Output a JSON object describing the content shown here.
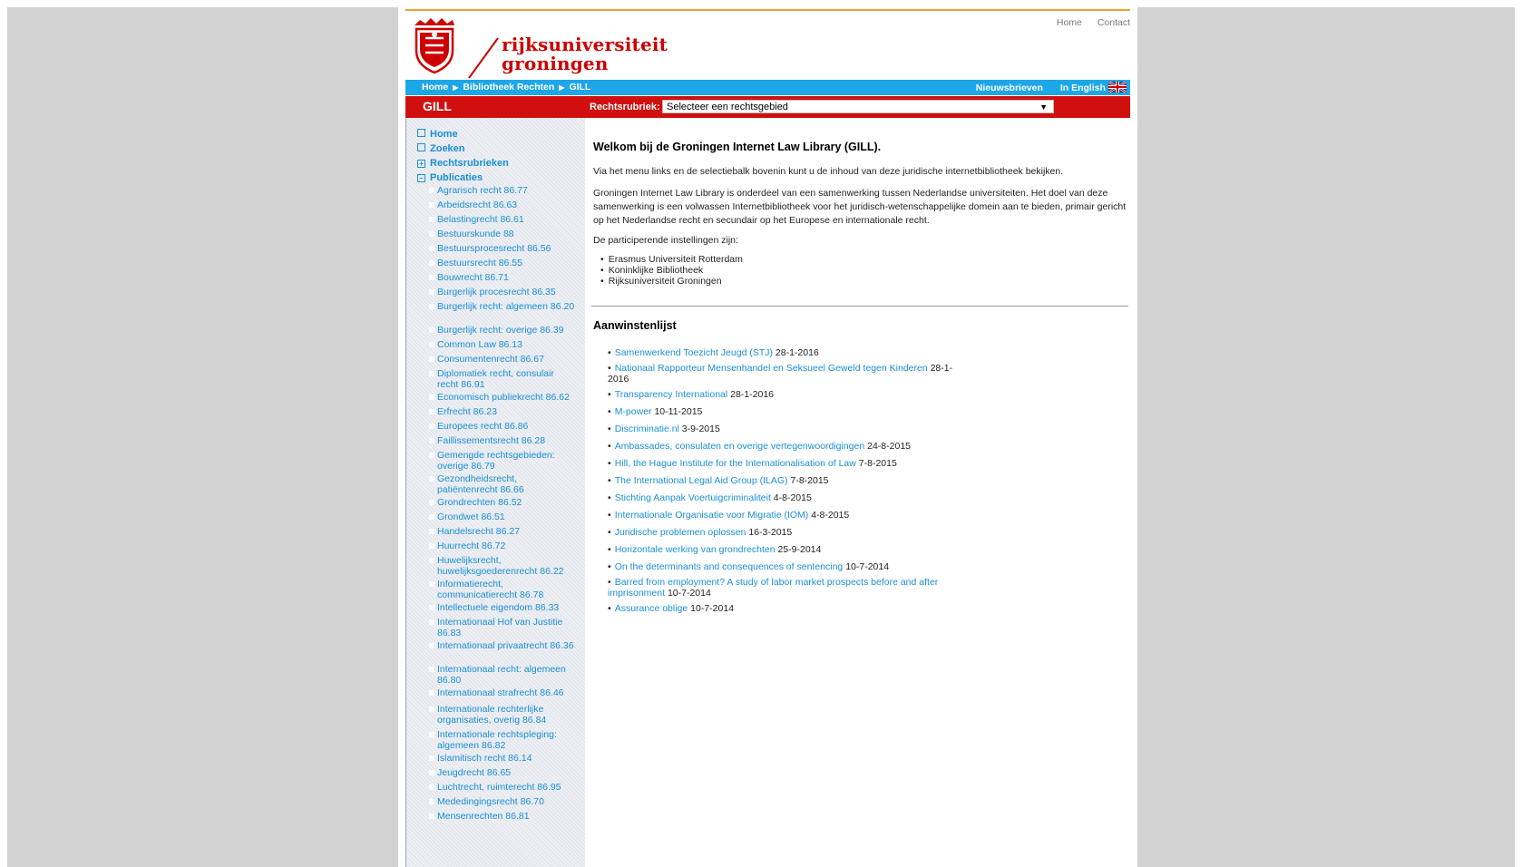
{
  "header": {
    "brand_line1": "rijksuniversiteit",
    "brand_line2": "groningen",
    "top_links": [
      "Home",
      "Contact"
    ]
  },
  "bluebar": {
    "breadcrumb": [
      "Home",
      "Bibliotheek Rechten",
      "GILL"
    ],
    "nieuwsbrieven": "Nieuwsbrieven",
    "english": "In English"
  },
  "redbar": {
    "title": "GILL",
    "rubriek_label": "Rechtsrubriek:",
    "rubriek_selected": "Selecteer een rechtsgebied"
  },
  "sidebar": {
    "nav": [
      {
        "label": "Home",
        "icon": "□"
      },
      {
        "label": "Zoeken",
        "icon": "□"
      },
      {
        "label": "Rechtsrubrieken",
        "icon": "+"
      },
      {
        "label": "Publicaties",
        "icon": "−"
      }
    ],
    "publicaties": [
      "Agrarisch recht 86.77",
      "Arbeidsrecht 86.63",
      "Belastingrecht 86.61",
      "Bestuurskunde 88",
      "Bestuursprocesrecht 86.56",
      "Bestuursrecht 86.55",
      "Bouwrecht 86.71",
      "Burgerlijk procesrecht 86.35",
      "Burgerlijk recht: algemeen 86.20",
      "Burgerlijk recht: overige 86.39",
      "Common Law 86.13",
      "Consumentenrecht 86.67",
      "Diplomatiek recht, consulair recht 86.91",
      "Economisch publiekrecht 86.62",
      "Erfrecht 86.23",
      "Europees recht 86.86",
      "Faillissementsrecht 86.28",
      "Gemengde rechtsgebieden: overige 86.79",
      "Gezondheidsrecht, patiëntenrecht 86.66",
      "Grondrechten 86.52",
      "Grondwet 86.51",
      "Handelsrecht 86.27",
      "Huurrecht 86.72",
      "Huwelijksrecht, huwelijksgoederenrecht 86.22",
      "Informatierecht, communicatierecht 86.78",
      "Intellectuele eigendom 86.33",
      "Internationaal Hof van Justitie 86.83",
      "Internationaal privaatrecht 86.36",
      "Internationaal recht: algemeen 86.80",
      "Internationaal strafrecht 86.46",
      "Internationale rechterlijke organisaties, overig 86.84",
      "Internationale rechtspleging: algemeen 86.82",
      "Islamitisch recht 86.14",
      "Jeugdrecht 86.65",
      "Luchtrecht, ruimterecht 86.95",
      "Mededingingsrecht 86.70",
      "Mensenrechten 86.81"
    ]
  },
  "main": {
    "welcome_title": "Welkom bij de Groningen Internet Law Library (GILL).",
    "intro": "Via het menu links en de selectiebalk bovenin kunt u de inhoud van deze juridische internetbibliotheek bekijken.",
    "about": "Groningen Internet Law Library is onderdeel van een samenwerking tussen Nederlandse universiteiten. Het doel van deze samenwerking is een volwassen Internetbibliotheek voor het juridisch-wetenschappelijke domein aan te bieden, primair gericht op het Nederlandse recht en secundair op het Europese en internationale recht.",
    "participants_intro": "De participerende instellingen zijn:",
    "participants": [
      "Erasmus Universiteit Rotterdam",
      "Koninklijke Bibliotheek",
      "Rijksuniversiteit Groningen"
    ],
    "aanwinsten_title": "Aanwinstenlijst",
    "aanwinsten": [
      {
        "title": "Samenwerkend Toezicht Jeugd (STJ)",
        "date": "28-1-2016"
      },
      {
        "title": "Nationaal Rapporteur Mensenhandel en Seksueel Geweld tegen Kinderen",
        "date": "28-1-2016"
      },
      {
        "title": "Transparency International",
        "date": "28-1-2016"
      },
      {
        "title": "M-power",
        "date": "10-11-2015"
      },
      {
        "title": "Discriminatie.nl",
        "date": "3-9-2015"
      },
      {
        "title": "Ambassades, consulaten en overige vertegenwoordigingen",
        "date": "24-8-2015"
      },
      {
        "title": "Hill, the Hague Institute for the Internationalisation of Law",
        "date": "7-8-2015"
      },
      {
        "title": "The International Legal Aid Group (ILAG)",
        "date": "7-8-2015"
      },
      {
        "title": "Stichting Aanpak Voertuigcriminaliteit",
        "date": "4-8-2015"
      },
      {
        "title": "Internationale Organisatie voor Migratie (IOM)",
        "date": "4-8-2015"
      },
      {
        "title": "Juridische problemen oplossen",
        "date": "16-3-2015"
      },
      {
        "title": "Horizontale werking van grondrechten",
        "date": "25-9-2014"
      },
      {
        "title": "On the determinants and consequences of sentencing",
        "date": "10-7-2014"
      },
      {
        "title": "Barred from employment? A study of labor market prospects before and after imprisonment",
        "date": "10-7-2014"
      },
      {
        "title": "Assurance oblige",
        "date": "10-7-2014"
      }
    ]
  },
  "colors": {
    "accent_blue": "#1da6e8",
    "link_blue": "#1a8fd8",
    "brand_red": "#cc0000",
    "bar_red": "#d10f0f",
    "top_line_orange": "#e8a23c"
  }
}
